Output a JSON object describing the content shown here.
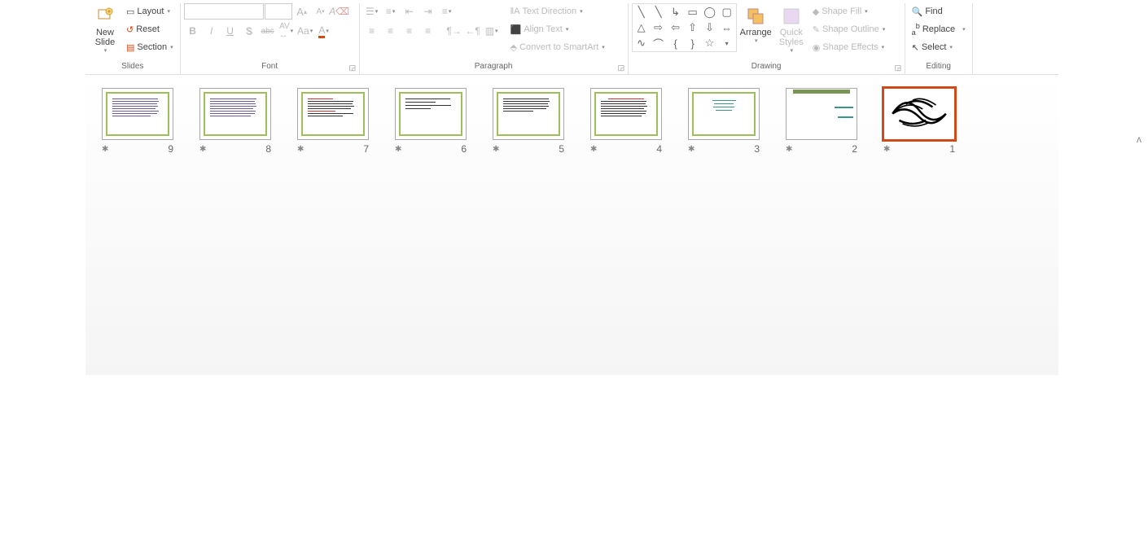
{
  "ribbon": {
    "slides": {
      "label": "Slides",
      "new_slide": "New\nSlide",
      "layout": "Layout",
      "reset": "Reset",
      "section": "Section"
    },
    "font": {
      "label": "Font",
      "bold": "B",
      "italic": "I",
      "underline": "U",
      "shadow": "S",
      "strike": "abc",
      "char_spacing": "AV",
      "case": "Aa",
      "font_color": "A",
      "grow": "A",
      "shrink": "A",
      "clear_fmt": "A"
    },
    "paragraph": {
      "label": "Paragraph",
      "text_direction": "Text Direction",
      "align_text": "Align Text",
      "smartart": "Convert to SmartArt"
    },
    "drawing": {
      "label": "Drawing",
      "arrange": "Arrange",
      "quick_styles": "Quick\nStyles",
      "shape_fill": "Shape Fill",
      "shape_outline": "Shape Outline",
      "shape_effects": "Shape Effects"
    },
    "editing": {
      "label": "Editing",
      "find": "Find",
      "replace": "Replace",
      "select": "Select"
    }
  },
  "slides": [
    {
      "num": "1",
      "type": "calligraphy"
    },
    {
      "num": "2",
      "type": "title-text"
    },
    {
      "num": "3",
      "type": "list-teal"
    },
    {
      "num": "4",
      "type": "text-red-title"
    },
    {
      "num": "5",
      "type": "text-dense"
    },
    {
      "num": "6",
      "type": "text-sparse"
    },
    {
      "num": "7",
      "type": "text-mixed"
    },
    {
      "num": "8",
      "type": "text-purple"
    },
    {
      "num": "9",
      "type": "text-purple"
    }
  ]
}
